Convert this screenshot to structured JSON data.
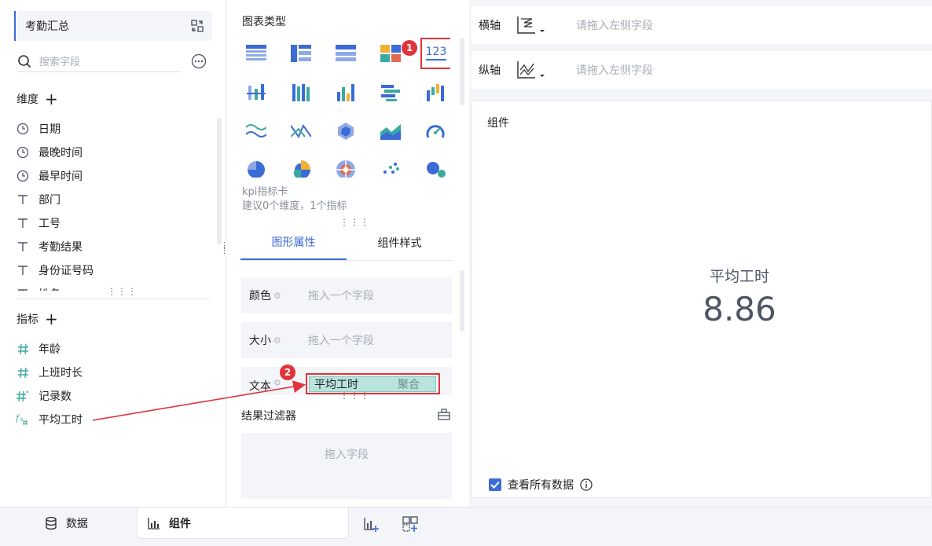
{
  "left": {
    "dataset_name": "考勤汇总",
    "search_placeholder": "搜索字段",
    "dimensions_title": "维度",
    "dimensions": [
      {
        "label": "日期",
        "icon": "clock-icon"
      },
      {
        "label": "最晚时间",
        "icon": "clock-icon"
      },
      {
        "label": "最早时间",
        "icon": "clock-icon"
      },
      {
        "label": "部门",
        "icon": "text-type-icon"
      },
      {
        "label": "工号",
        "icon": "text-type-icon"
      },
      {
        "label": "考勤结果",
        "icon": "text-type-icon"
      },
      {
        "label": "身份证号码",
        "icon": "text-type-icon"
      },
      {
        "label": "姓名",
        "icon": "text-type-icon"
      }
    ],
    "measures_title": "指标",
    "measures": [
      {
        "label": "年龄",
        "icon": "hash-icon"
      },
      {
        "label": "上班时长",
        "icon": "hash-icon"
      },
      {
        "label": "记录数",
        "icon": "hash-star-icon"
      },
      {
        "label": "平均工时",
        "icon": "formula-icon"
      }
    ]
  },
  "middle": {
    "chart_type_title": "图表类型",
    "kpi_name": "kpi指标卡",
    "kpi_hint": "建议0个维度，1个指标",
    "tabs": [
      "图形属性",
      "组件样式"
    ],
    "props": {
      "color_label": "颜色",
      "size_label": "大小",
      "text_label": "文本",
      "drop_placeholder": "拖入一个字段"
    },
    "text_chip": {
      "field": "平均工时",
      "agg": "聚合"
    },
    "filter_title": "结果过滤器",
    "filter_placeholder": "拖入字段"
  },
  "right": {
    "x_axis_label": "横轴",
    "y_axis_label": "纵轴",
    "axis_placeholder": "请拖入左侧字段",
    "canvas_title": "组件",
    "kpi": {
      "name": "平均工时",
      "value": "8.86"
    },
    "view_all_label": "查看所有数据"
  },
  "bottom": {
    "data_tab": "数据",
    "component_tab": "组件"
  },
  "annotations": {
    "badge_1": "1",
    "badge_2": "2",
    "accent_color": "#e0343a"
  },
  "colors": {
    "primary": "#3b6bd6",
    "measure": "#3aa99f",
    "panel_bg": "#f3f5f8"
  }
}
